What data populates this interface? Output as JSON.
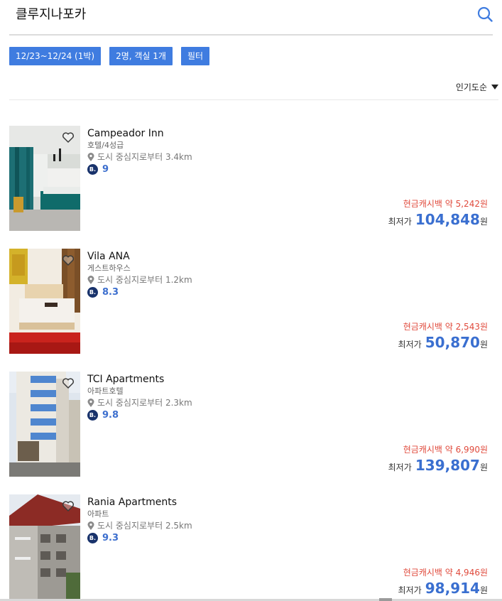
{
  "search": {
    "query": "클루지나포카"
  },
  "filters": {
    "dates": "12/23~12/24 (1박)",
    "guests": "2명, 객실 1개",
    "filter": "필터"
  },
  "sort": {
    "label": "인기도순"
  },
  "hotels": [
    {
      "name": "Campeador Inn",
      "type": "호텔/4성급",
      "distance": "도시 중심지로부터 3.4km",
      "score": "9",
      "cashback": "현금캐시백 약 5,242원",
      "lowest_label": "최저가",
      "price": "104,848",
      "currency": "원"
    },
    {
      "name": "Vila ANA",
      "type": "게스트하우스",
      "distance": "도시 중심지로부터 1.2km",
      "score": "8.3",
      "cashback": "현금캐시백 약 2,543원",
      "lowest_label": "최저가",
      "price": "50,870",
      "currency": "원"
    },
    {
      "name": "TCI Apartments",
      "type": "아파트호텔",
      "distance": "도시 중심지로부터 2.3km",
      "score": "9.8",
      "cashback": "현금캐시백 약 6,990원",
      "lowest_label": "최저가",
      "price": "139,807",
      "currency": "원"
    },
    {
      "name": "Rania Apartments",
      "type": "아파트",
      "distance": "도시 중심지로부터 2.5km",
      "score": "9.3",
      "cashback": "현금캐시백 약 4,946원",
      "lowest_label": "최저가",
      "price": "98,914",
      "currency": "원"
    }
  ],
  "badge_letter": "B.",
  "colors": {
    "accent": "#3f7ce0",
    "price": "#3a6fd0",
    "cashback": "#e04a3c",
    "badge": "#18326b"
  }
}
